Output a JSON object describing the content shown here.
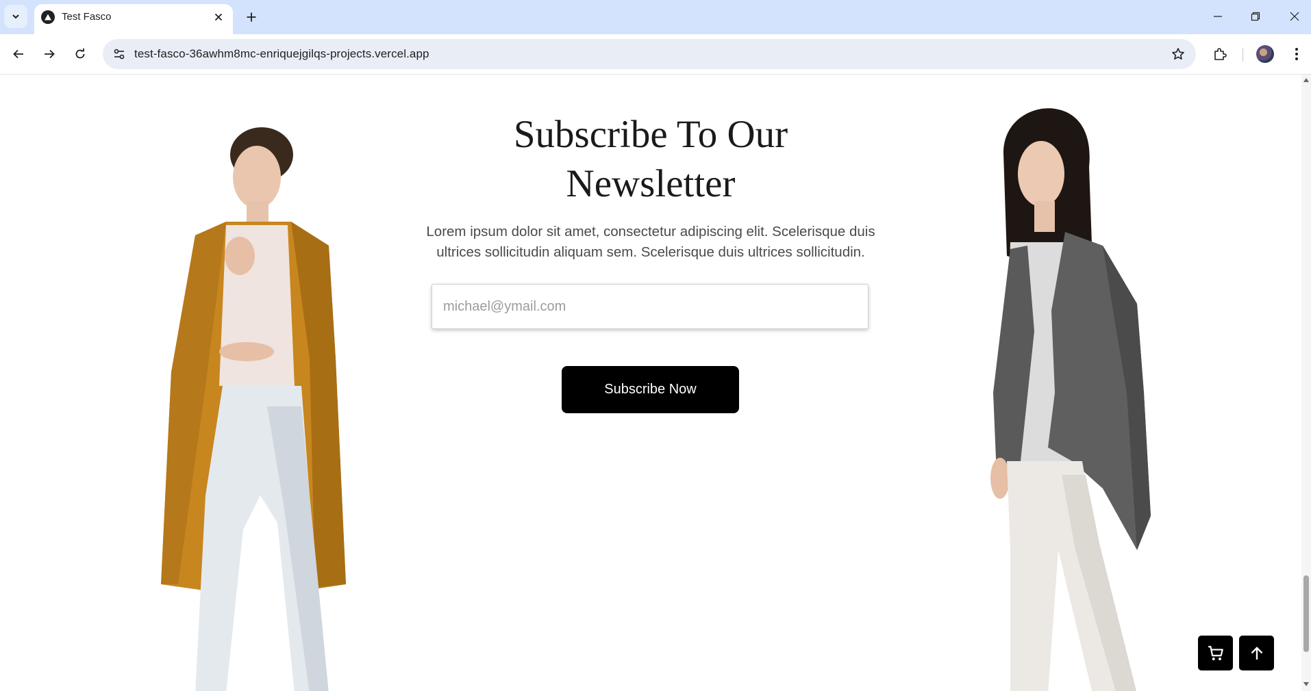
{
  "browser": {
    "tab_title": "Test Fasco",
    "url": "test-fasco-36awhm8mc-enriquejgilqs-projects.vercel.app"
  },
  "newsletter": {
    "title_line1": "Subscribe To Our",
    "title_line2": "Newsletter",
    "description": "Lorem ipsum dolor sit amet, consectetur adipiscing elit. Scelerisque duis ultrices sollicitudin aliquam sem. Scelerisque duis ultrices sollicitudin.",
    "email_placeholder": "michael@ymail.com",
    "email_value": "",
    "button_label": "Subscribe Now"
  },
  "colors": {
    "tab_strip": "#d3e3fd",
    "button_bg": "#000000",
    "coat_left": "#c8861e",
    "blazer_right": "#5f5f5f"
  },
  "icons": {
    "floating_cart": "cart-icon",
    "floating_top": "arrow-up-icon"
  }
}
